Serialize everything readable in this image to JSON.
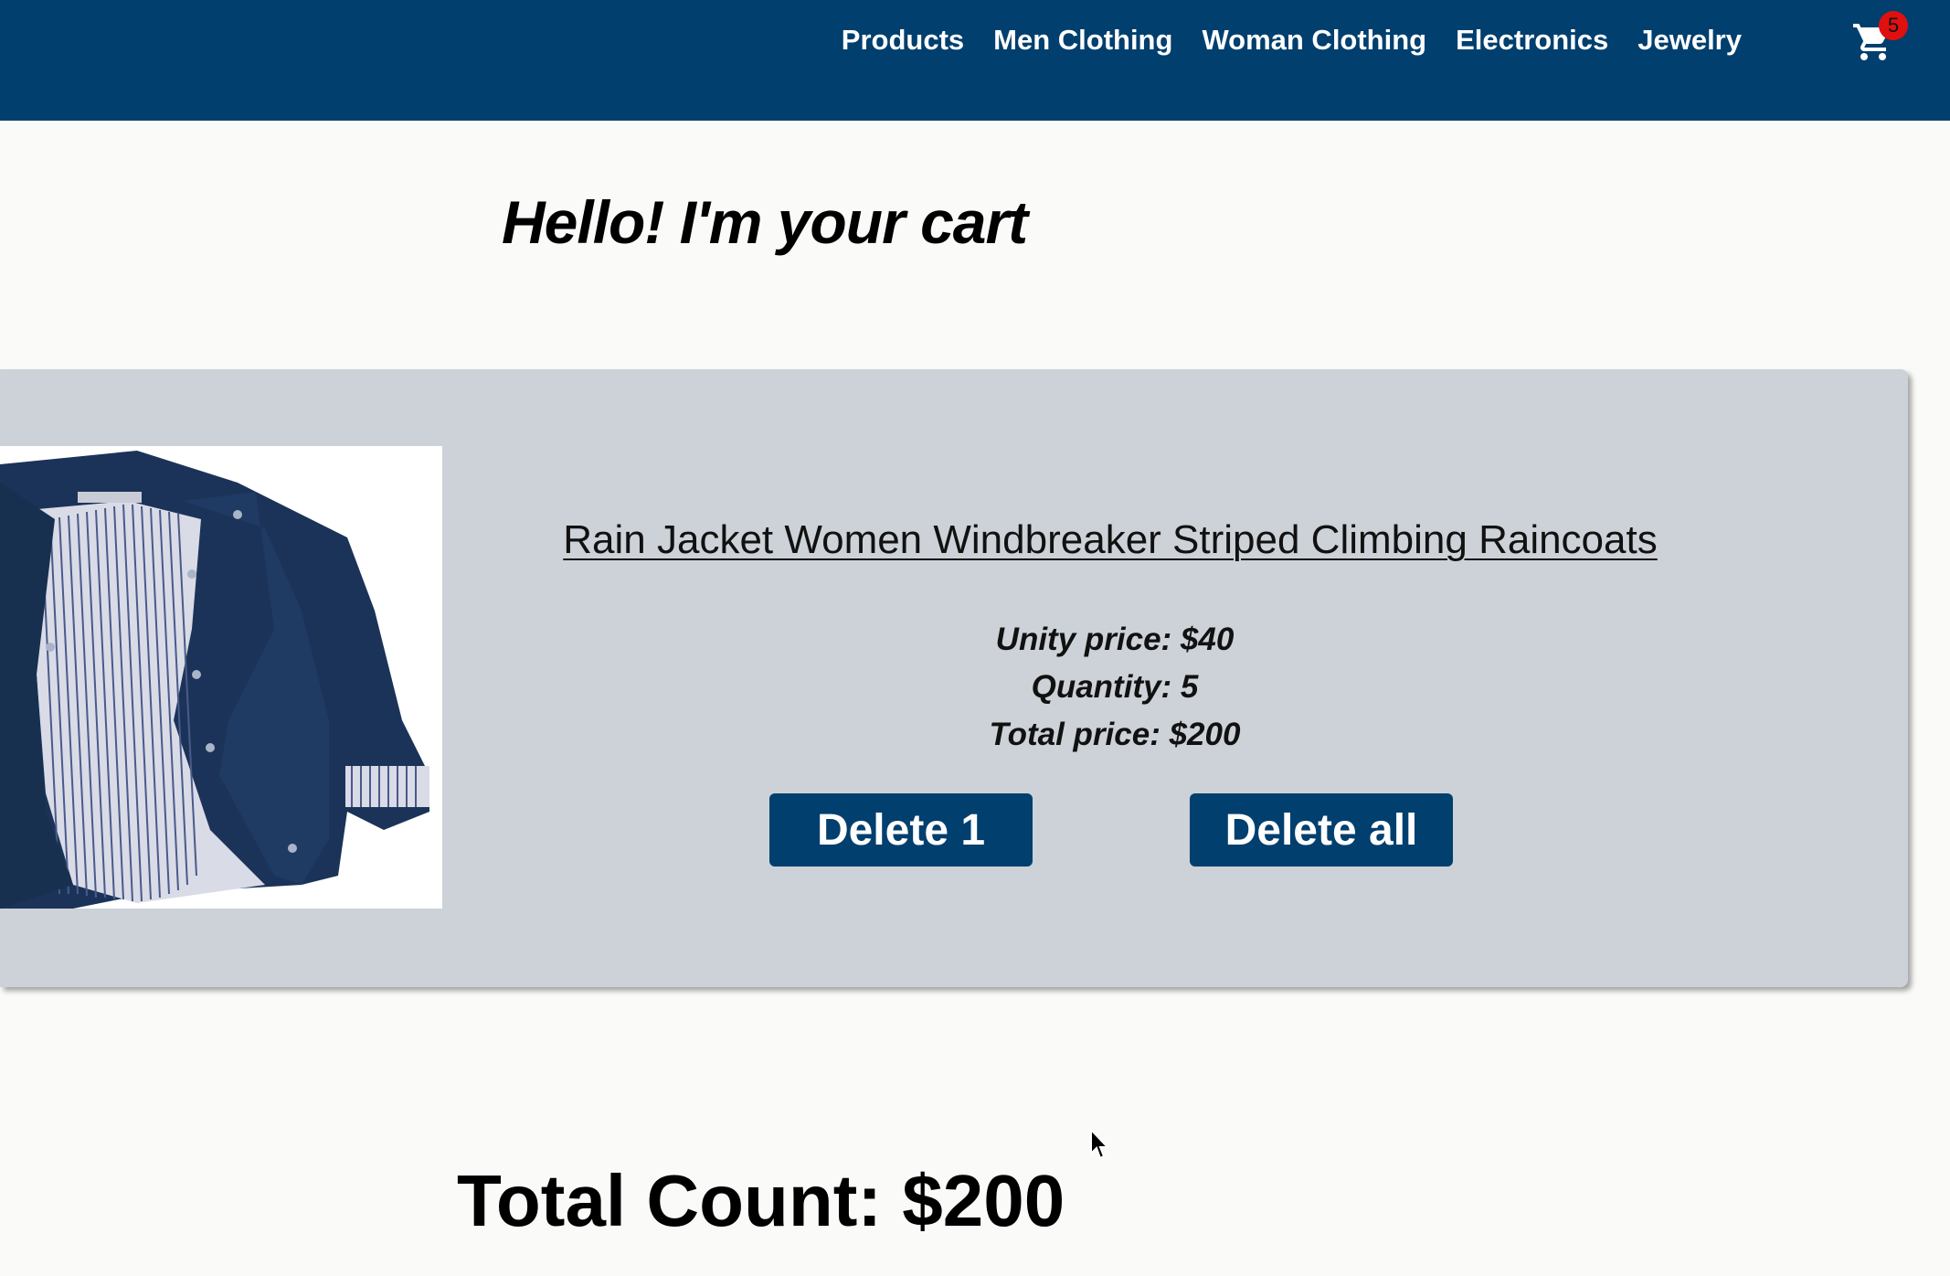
{
  "nav": {
    "links": [
      "Products",
      "Men Clothing",
      "Woman Clothing",
      "Electronics",
      "Jewelry"
    ],
    "cart_icon": "shopping-cart-icon",
    "cart_count": "5"
  },
  "page": {
    "title": "Hello! I'm your cart"
  },
  "cart": {
    "items": [
      {
        "name": "Rain Jacket Women Windbreaker Striped Climbing Raincoats",
        "unit_price": "Unity price: $40",
        "quantity": "Quantity: 5",
        "total_price": "Total price: $200",
        "delete_one_label": "Delete 1",
        "delete_all_label": "Delete all"
      }
    ]
  },
  "total": {
    "label": "Total Count: $200"
  },
  "colors": {
    "navbar": "#003f6e",
    "button": "#003f6e",
    "card": "#ccd2d7",
    "badge": "#e01010"
  }
}
